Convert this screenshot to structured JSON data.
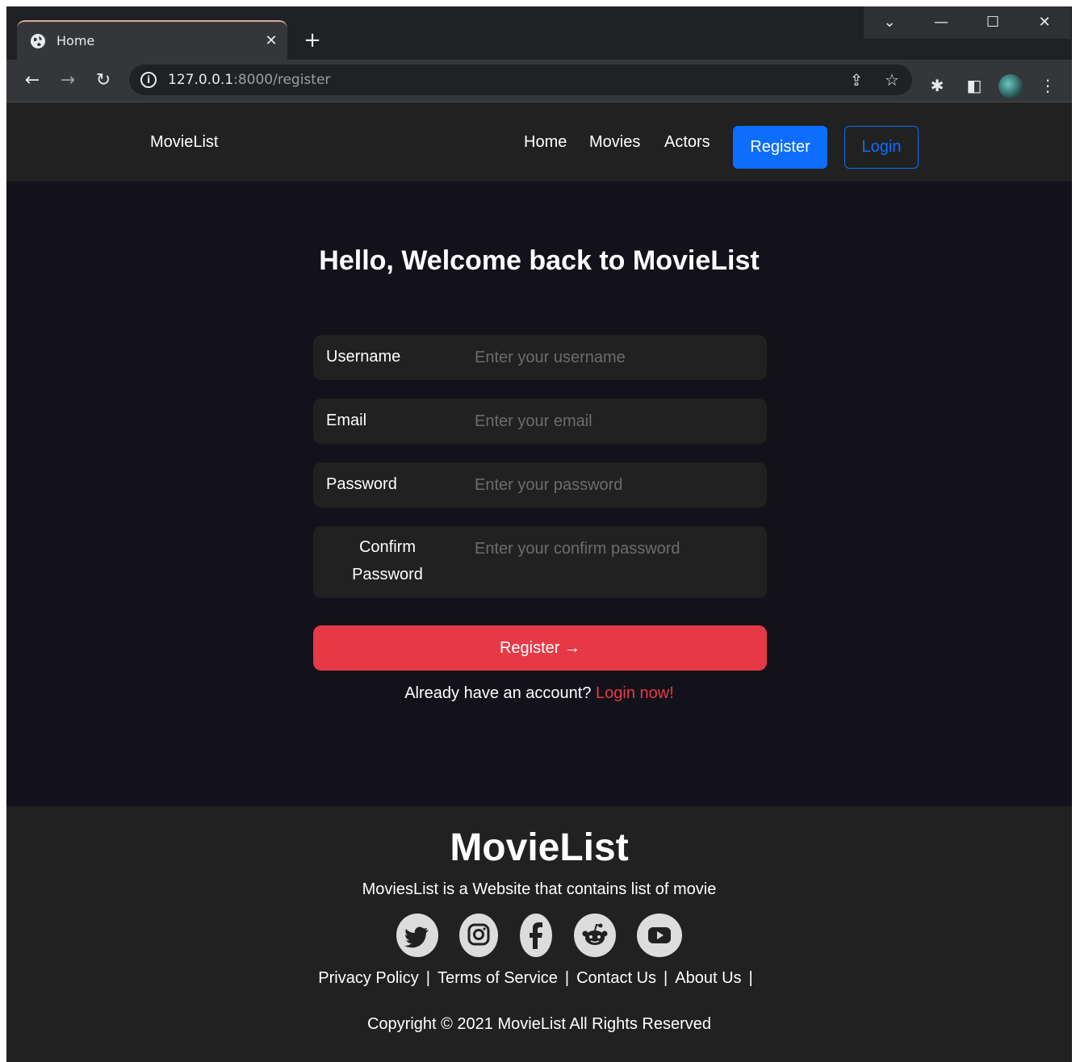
{
  "browser": {
    "tab_title": "Home",
    "tab_icon": "globe-icon",
    "url_host": "127.0.0.1",
    "url_rest": ":8000/register"
  },
  "nav": {
    "brand": "MovieList",
    "links": [
      "Home",
      "Movies",
      "Actors"
    ],
    "register_label": "Register",
    "login_label": "Login"
  },
  "form": {
    "heading": "Hello, Welcome back to MovieList",
    "fields": [
      {
        "label": "Username",
        "placeholder": "Enter your username",
        "value": ""
      },
      {
        "label": "Email",
        "placeholder": "Enter your email",
        "value": ""
      },
      {
        "label": "Password",
        "placeholder": "Enter your password",
        "value": ""
      },
      {
        "label_line1": "Confirm",
        "label_line2": "Password",
        "placeholder": "Enter your confirm password",
        "value": ""
      }
    ],
    "submit_label": "Register",
    "submit_arrow": "→",
    "already_text": "Already have an account?",
    "login_now": "Login now!"
  },
  "footer": {
    "brand": "MovieList",
    "description": "MoviesList is a Website that contains list of movie",
    "social": [
      "twitter-icon",
      "instagram-icon",
      "facebook-icon",
      "reddit-icon",
      "youtube-icon"
    ],
    "links": [
      "Privacy Policy",
      "Terms of Service",
      "Contact Us",
      "About Us"
    ],
    "separator": "|",
    "copyright": "Copyright © 2021 MovieList All Rights Reserved"
  },
  "colors": {
    "primary": "#0d6efd",
    "accent": "#e63946",
    "panel": "#212121",
    "background": "#13121a"
  }
}
